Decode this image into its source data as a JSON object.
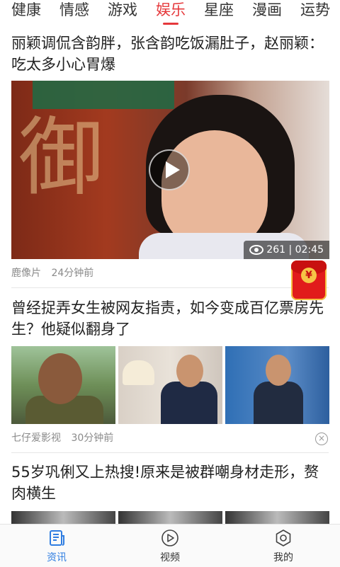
{
  "tabs": [
    "健康",
    "情感",
    "游戏",
    "娱乐",
    "星座",
    "漫画",
    "运势"
  ],
  "active_tab": "娱乐",
  "articles": [
    {
      "title": "丽颖调侃含韵胖，张含韵吃饭漏肚子，赵丽颖：吃太多小心胃爆",
      "views": "261",
      "duration": "02:45",
      "source": "鹿像片",
      "time": "24分钟前"
    },
    {
      "title": "曾经捉弄女生被网友指责，如今变成百亿票房先生？他疑似翻身了",
      "source": "七仔爱影视",
      "time": "30分钟前"
    },
    {
      "title": "55岁巩俐又上热搜!原来是被群嘲身材走形，赘肉横生"
    }
  ],
  "bottom_nav": [
    {
      "label": "资讯",
      "icon": "news-icon",
      "active": true
    },
    {
      "label": "视频",
      "icon": "play-circle-icon",
      "active": false
    },
    {
      "label": "我的",
      "icon": "profile-icon",
      "active": false
    }
  ],
  "colors": {
    "accent": "#e5383b",
    "nav_active": "#2f7de1"
  },
  "redpacket_symbol": "¥"
}
